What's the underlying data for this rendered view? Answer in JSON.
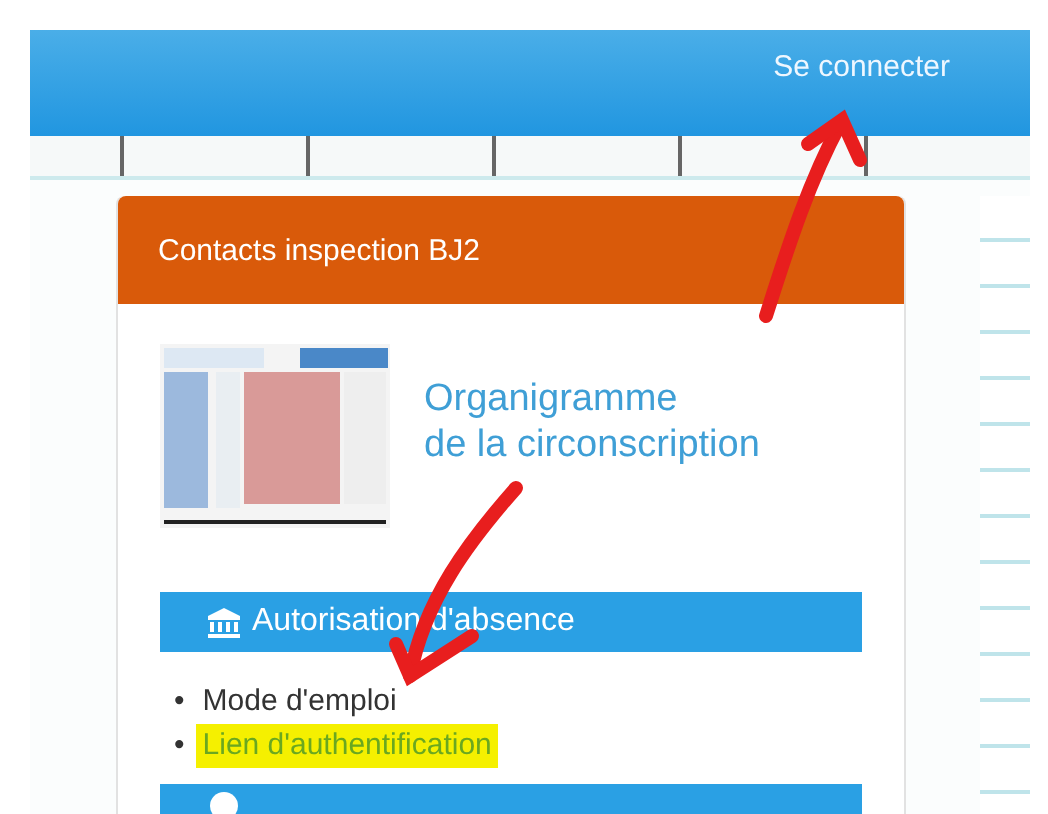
{
  "header": {
    "login_link": "Se connecter"
  },
  "card": {
    "title": "Contacts inspection BJ2",
    "feature": {
      "kind": "picture",
      "title_lines": [
        "Organigramme",
        "de la circonscription"
      ]
    },
    "sections": [
      {
        "kind": "list",
        "title": "Autorisation d'absence",
        "items": [
          {
            "bullet": "•",
            "label": "Mode d'emploi",
            "kind": "text",
            "highlighted": false
          },
          {
            "bullet": "•",
            "label": "Lien d'authentification",
            "kind": "link",
            "highlighted": true
          }
        ]
      },
      {
        "kind": "header_only"
      }
    ]
  }
}
